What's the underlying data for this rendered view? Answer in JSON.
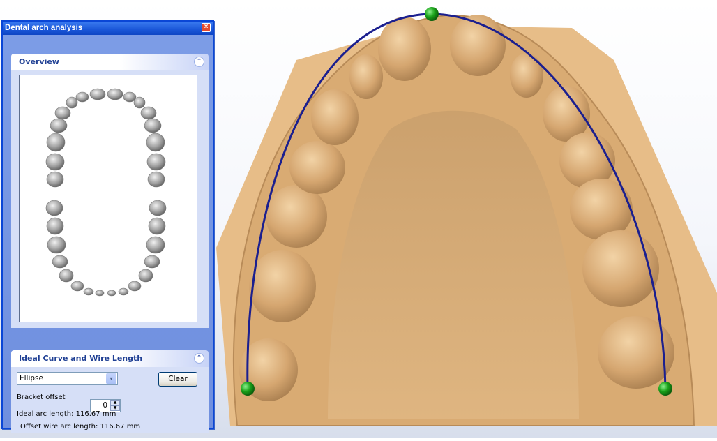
{
  "panel": {
    "title": "Dental arch analysis",
    "close_glyph": "×"
  },
  "overview": {
    "header": "Overview",
    "collapse_glyph": "⌃"
  },
  "curve_section": {
    "header": "Ideal Curve and Wire Length",
    "collapse_glyph": "⌃",
    "shape_value": "Ellipse",
    "dropdown_glyph": "▾",
    "clear_label": "Clear",
    "bracket_offset_label": "Bracket offset",
    "bracket_offset_value": "0",
    "spin_up_glyph": "▲",
    "spin_down_glyph": "▼",
    "ideal_arc_length": "Ideal arc length: 116.67 mm",
    "offset_arc_length": "Offset wire arc length: 116.67 mm"
  },
  "colors": {
    "model": "#e7bd88",
    "arch_curve": "#1b1f8f",
    "control_point": "#1aa21a"
  },
  "icons": {
    "close": "close-icon",
    "collapse": "chevron-up-icon",
    "dropdown": "chevron-down-icon"
  }
}
